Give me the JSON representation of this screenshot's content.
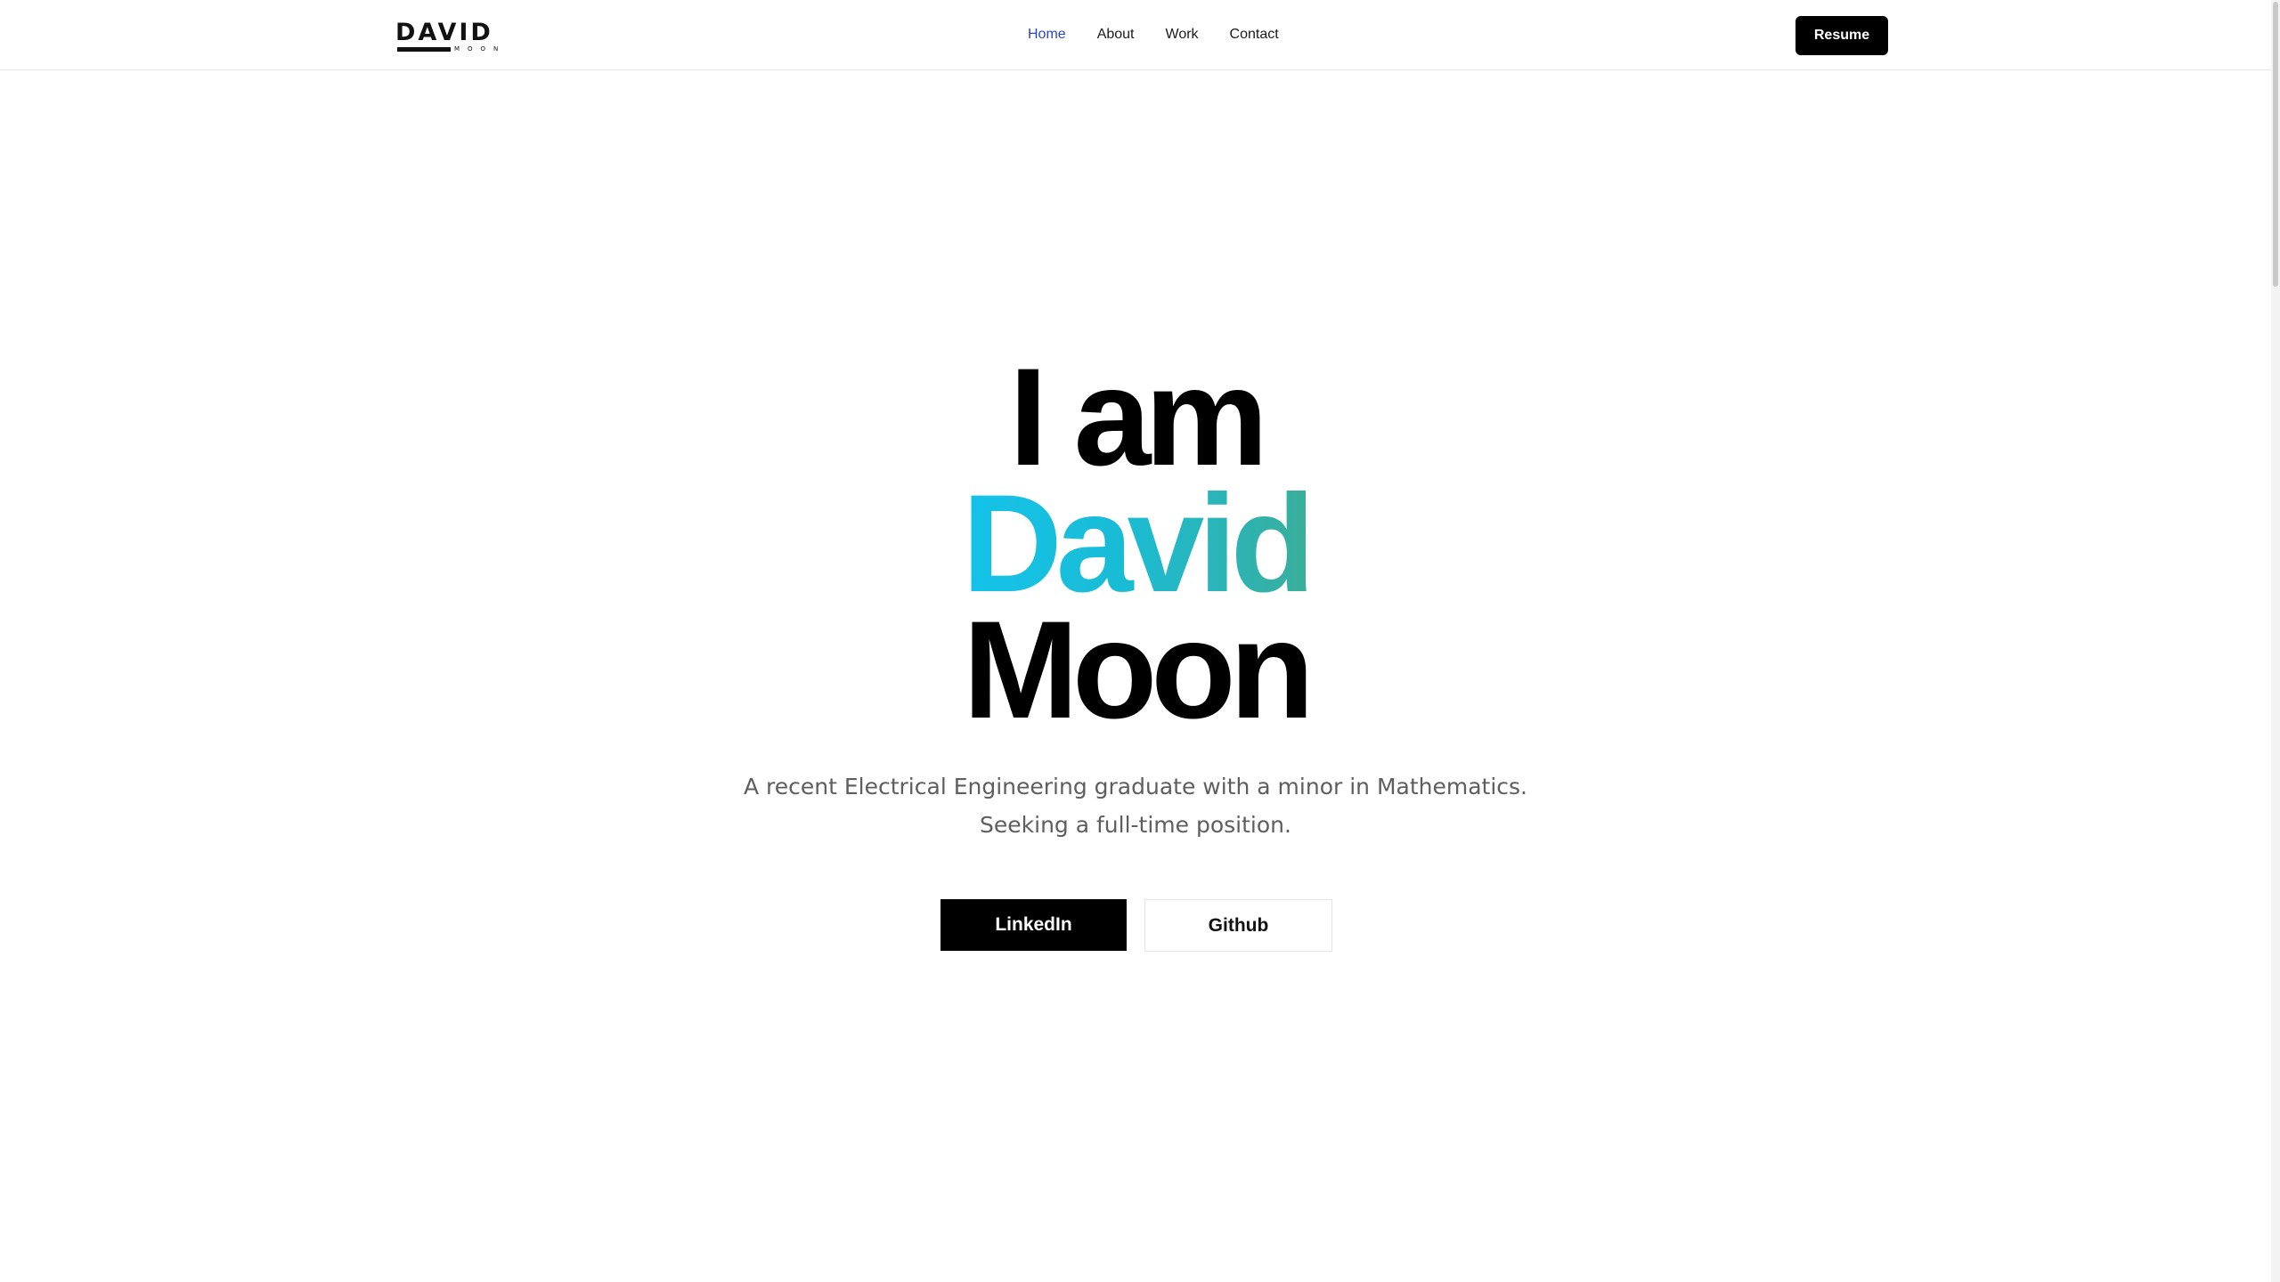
{
  "logo": {
    "word": "DAVID",
    "sub": "MOON"
  },
  "nav": {
    "links": [
      "Home",
      "About",
      "Work",
      "Contact"
    ],
    "active": "Home",
    "resume_label": "Resume"
  },
  "hero": {
    "line1": "I am",
    "line2": "David",
    "line3": "Moon",
    "subtitle_line1": "A recent Electrical Engineering graduate with a minor in Mathematics.",
    "subtitle_line2": "Seeking a full-time position.",
    "primary_button": "LinkedIn",
    "secondary_button": "Github"
  },
  "colors": {
    "nav_active": "#2b46c2",
    "name_gradient_start": "#14c3ea",
    "name_gradient_end": "#3aae9b",
    "subtitle_text": "#5e5e5e"
  }
}
